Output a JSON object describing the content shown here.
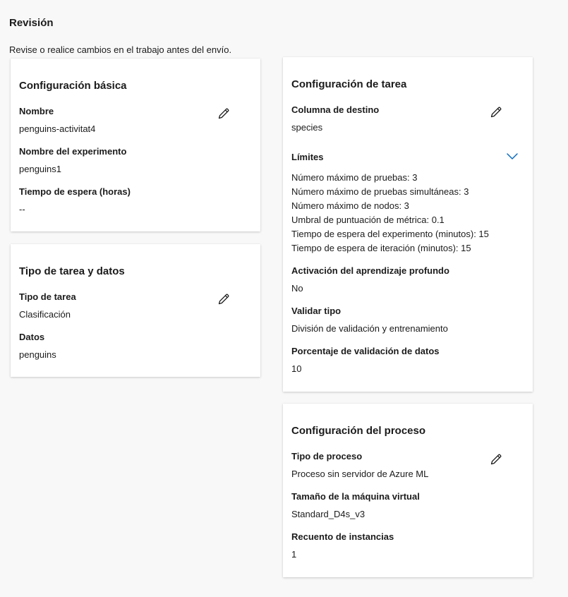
{
  "page": {
    "title": "Revisión",
    "subtitle": "Revise o realice cambios en el trabajo antes del envío."
  },
  "basic": {
    "title": "Configuración básica",
    "name_label": "Nombre",
    "name_value": "penguins-activitat4",
    "experiment_label": "Nombre del experimento",
    "experiment_value": "penguins1",
    "timeout_label": "Tiempo de espera (horas)",
    "timeout_value": "--"
  },
  "task_data": {
    "title": "Tipo de tarea y datos",
    "task_type_label": "Tipo de tarea",
    "task_type_value": "Clasificación",
    "data_label": "Datos",
    "data_value": "penguins"
  },
  "task_config": {
    "title": "Configuración de tarea",
    "target_label": "Columna de destino",
    "target_value": "species",
    "limits_label": "Límites",
    "limits": [
      "Número máximo de pruebas: 3",
      "Número máximo de pruebas simultáneas: 3",
      "Número máximo de nodos: 3",
      "Umbral de puntuación de métrica: 0.1",
      "Tiempo de espera del experimento (minutos): 15",
      "Tiempo de espera de iteración (minutos): 15"
    ],
    "deep_learning_label": "Activación del aprendizaje profundo",
    "deep_learning_value": "No",
    "validation_label": "Validar tipo",
    "validation_value": "División de validación y entrenamiento",
    "validation_pct_label": "Porcentaje de validación de datos",
    "validation_pct_value": "10"
  },
  "compute": {
    "title": "Configuración del proceso",
    "compute_type_label": "Tipo de proceso",
    "compute_type_value": "Proceso sin servidor de Azure ML",
    "vm_size_label": "Tamaño de la máquina virtual",
    "vm_size_value": "Standard_D4s_v3",
    "instances_label": "Recuento de instancias",
    "instances_value": "1"
  },
  "icons": {
    "edit": "pencil-icon",
    "expand": "chevron-down-icon"
  },
  "colors": {
    "accent": "#0f6cbd",
    "background": "#f8f8f8",
    "card": "#ffffff"
  }
}
